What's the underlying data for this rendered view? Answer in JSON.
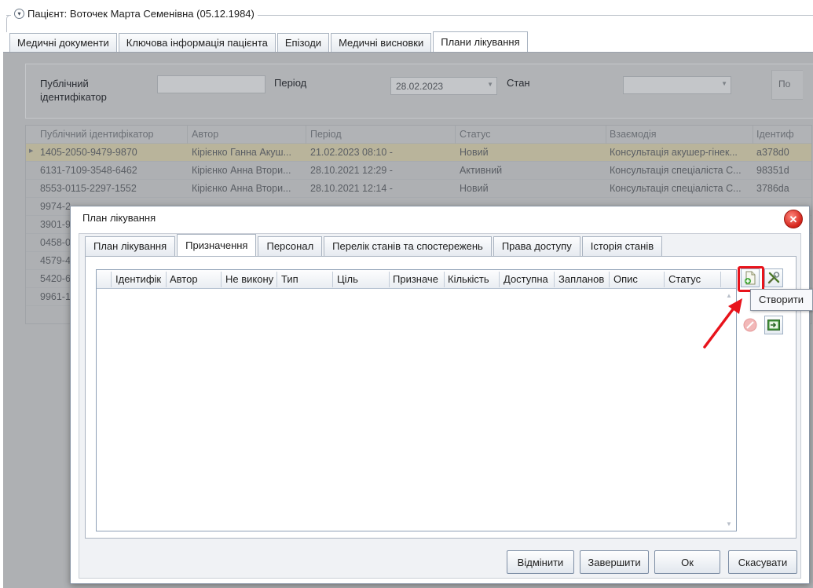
{
  "patient": {
    "label": "Пацієнт: Воточек Марта Семенівна (05.12.1984)"
  },
  "main_tabs": [
    {
      "label": "Медичні документи"
    },
    {
      "label": "Ключова інформація пацієнта"
    },
    {
      "label": "Епізоди"
    },
    {
      "label": "Медичні висновки"
    },
    {
      "label": "Плани лікування",
      "active": true
    }
  ],
  "filters": {
    "public_id_label": "Публічний\nідентифікатор",
    "public_id_value": "",
    "period_label": "Період",
    "period_value": "28.02.2023",
    "state_label": "Стан",
    "state_value": "",
    "cut_button": "По"
  },
  "background_grid": {
    "columns": [
      "Публічний ідентифікатор",
      "Автор",
      "Період",
      "Статус",
      "Взаємодія",
      "Ідентиф"
    ],
    "rows": [
      [
        "1405-2050-9479-9870",
        "Кірієнко Ганна Акуш...",
        "21.02.2023 08:10 -",
        "Новий",
        "Консультація акушер-гінек...",
        "a378d0"
      ],
      [
        "6131-7109-3548-6462",
        "Кірієнко Анна Втори...",
        "28.10.2021 12:29 -",
        "Активний",
        "Консультація спеціаліста С...",
        "98351d"
      ],
      [
        "8553-0115-2297-1552",
        "Кірієнко Анна Втори...",
        "28.10.2021 12:14 -",
        "Новий",
        "Консультація спеціаліста С...",
        "3786da"
      ],
      [
        "9974-2",
        "",
        "",
        "",
        "",
        ""
      ],
      [
        "3901-9",
        "",
        "",
        "",
        "",
        ""
      ],
      [
        "0458-0",
        "",
        "",
        "",
        "",
        ""
      ],
      [
        "4579-4",
        "",
        "",
        "",
        "",
        ""
      ],
      [
        "5420-6",
        "",
        "",
        "",
        "",
        ""
      ],
      [
        "9961-1",
        "",
        "",
        "",
        "",
        ""
      ]
    ]
  },
  "dialog": {
    "title": "План лікування",
    "tabs": [
      {
        "label": "План лікування"
      },
      {
        "label": "Призначення",
        "active": true
      },
      {
        "label": "Персонал"
      },
      {
        "label": "Перелік станів та спостережень"
      },
      {
        "label": "Права доступу"
      },
      {
        "label": "Історія станів"
      }
    ],
    "grid_columns": [
      "Ідентифік",
      "Автор",
      "Не викону",
      "Тип",
      "Ціль",
      "Призначе",
      "Кількість",
      "Доступна",
      "Запланов",
      "Опис",
      "Статус"
    ],
    "tooltip": "Створити",
    "buttons": {
      "cancel_action": "Відмінити",
      "complete": "Завершити",
      "ok": "Ок",
      "close": "Скасувати"
    }
  },
  "icons": {
    "create": "document-add-icon",
    "edit": "tools-icon",
    "cancel": "cancel-icon",
    "export": "export-icon"
  },
  "colors": {
    "highlight": "#e8131b",
    "selected_row": "#b9b49b",
    "close_button": "#d32219"
  }
}
